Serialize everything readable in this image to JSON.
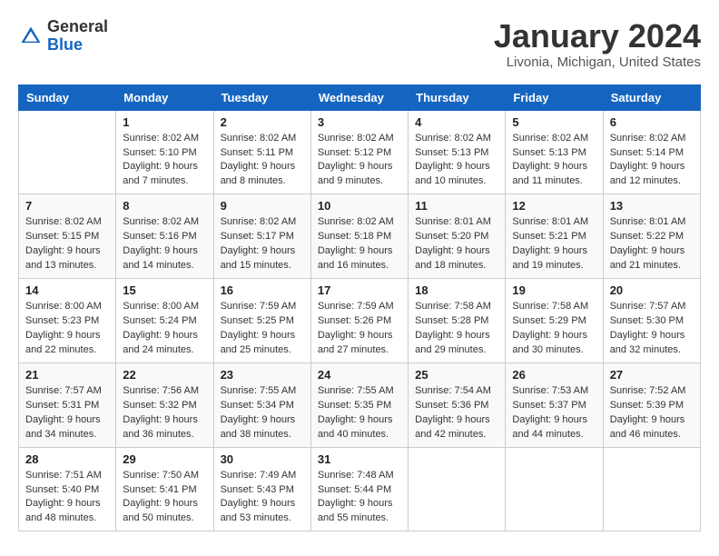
{
  "header": {
    "logo_general": "General",
    "logo_blue": "Blue",
    "title": "January 2024",
    "location": "Livonia, Michigan, United States"
  },
  "days_of_week": [
    "Sunday",
    "Monday",
    "Tuesday",
    "Wednesday",
    "Thursday",
    "Friday",
    "Saturday"
  ],
  "weeks": [
    [
      {
        "day": "",
        "sunrise": "",
        "sunset": "",
        "daylight": ""
      },
      {
        "day": "1",
        "sunrise": "Sunrise: 8:02 AM",
        "sunset": "Sunset: 5:10 PM",
        "daylight": "Daylight: 9 hours and 7 minutes."
      },
      {
        "day": "2",
        "sunrise": "Sunrise: 8:02 AM",
        "sunset": "Sunset: 5:11 PM",
        "daylight": "Daylight: 9 hours and 8 minutes."
      },
      {
        "day": "3",
        "sunrise": "Sunrise: 8:02 AM",
        "sunset": "Sunset: 5:12 PM",
        "daylight": "Daylight: 9 hours and 9 minutes."
      },
      {
        "day": "4",
        "sunrise": "Sunrise: 8:02 AM",
        "sunset": "Sunset: 5:13 PM",
        "daylight": "Daylight: 9 hours and 10 minutes."
      },
      {
        "day": "5",
        "sunrise": "Sunrise: 8:02 AM",
        "sunset": "Sunset: 5:13 PM",
        "daylight": "Daylight: 9 hours and 11 minutes."
      },
      {
        "day": "6",
        "sunrise": "Sunrise: 8:02 AM",
        "sunset": "Sunset: 5:14 PM",
        "daylight": "Daylight: 9 hours and 12 minutes."
      }
    ],
    [
      {
        "day": "7",
        "sunrise": "Sunrise: 8:02 AM",
        "sunset": "Sunset: 5:15 PM",
        "daylight": "Daylight: 9 hours and 13 minutes."
      },
      {
        "day": "8",
        "sunrise": "Sunrise: 8:02 AM",
        "sunset": "Sunset: 5:16 PM",
        "daylight": "Daylight: 9 hours and 14 minutes."
      },
      {
        "day": "9",
        "sunrise": "Sunrise: 8:02 AM",
        "sunset": "Sunset: 5:17 PM",
        "daylight": "Daylight: 9 hours and 15 minutes."
      },
      {
        "day": "10",
        "sunrise": "Sunrise: 8:02 AM",
        "sunset": "Sunset: 5:18 PM",
        "daylight": "Daylight: 9 hours and 16 minutes."
      },
      {
        "day": "11",
        "sunrise": "Sunrise: 8:01 AM",
        "sunset": "Sunset: 5:20 PM",
        "daylight": "Daylight: 9 hours and 18 minutes."
      },
      {
        "day": "12",
        "sunrise": "Sunrise: 8:01 AM",
        "sunset": "Sunset: 5:21 PM",
        "daylight": "Daylight: 9 hours and 19 minutes."
      },
      {
        "day": "13",
        "sunrise": "Sunrise: 8:01 AM",
        "sunset": "Sunset: 5:22 PM",
        "daylight": "Daylight: 9 hours and 21 minutes."
      }
    ],
    [
      {
        "day": "14",
        "sunrise": "Sunrise: 8:00 AM",
        "sunset": "Sunset: 5:23 PM",
        "daylight": "Daylight: 9 hours and 22 minutes."
      },
      {
        "day": "15",
        "sunrise": "Sunrise: 8:00 AM",
        "sunset": "Sunset: 5:24 PM",
        "daylight": "Daylight: 9 hours and 24 minutes."
      },
      {
        "day": "16",
        "sunrise": "Sunrise: 7:59 AM",
        "sunset": "Sunset: 5:25 PM",
        "daylight": "Daylight: 9 hours and 25 minutes."
      },
      {
        "day": "17",
        "sunrise": "Sunrise: 7:59 AM",
        "sunset": "Sunset: 5:26 PM",
        "daylight": "Daylight: 9 hours and 27 minutes."
      },
      {
        "day": "18",
        "sunrise": "Sunrise: 7:58 AM",
        "sunset": "Sunset: 5:28 PM",
        "daylight": "Daylight: 9 hours and 29 minutes."
      },
      {
        "day": "19",
        "sunrise": "Sunrise: 7:58 AM",
        "sunset": "Sunset: 5:29 PM",
        "daylight": "Daylight: 9 hours and 30 minutes."
      },
      {
        "day": "20",
        "sunrise": "Sunrise: 7:57 AM",
        "sunset": "Sunset: 5:30 PM",
        "daylight": "Daylight: 9 hours and 32 minutes."
      }
    ],
    [
      {
        "day": "21",
        "sunrise": "Sunrise: 7:57 AM",
        "sunset": "Sunset: 5:31 PM",
        "daylight": "Daylight: 9 hours and 34 minutes."
      },
      {
        "day": "22",
        "sunrise": "Sunrise: 7:56 AM",
        "sunset": "Sunset: 5:32 PM",
        "daylight": "Daylight: 9 hours and 36 minutes."
      },
      {
        "day": "23",
        "sunrise": "Sunrise: 7:55 AM",
        "sunset": "Sunset: 5:34 PM",
        "daylight": "Daylight: 9 hours and 38 minutes."
      },
      {
        "day": "24",
        "sunrise": "Sunrise: 7:55 AM",
        "sunset": "Sunset: 5:35 PM",
        "daylight": "Daylight: 9 hours and 40 minutes."
      },
      {
        "day": "25",
        "sunrise": "Sunrise: 7:54 AM",
        "sunset": "Sunset: 5:36 PM",
        "daylight": "Daylight: 9 hours and 42 minutes."
      },
      {
        "day": "26",
        "sunrise": "Sunrise: 7:53 AM",
        "sunset": "Sunset: 5:37 PM",
        "daylight": "Daylight: 9 hours and 44 minutes."
      },
      {
        "day": "27",
        "sunrise": "Sunrise: 7:52 AM",
        "sunset": "Sunset: 5:39 PM",
        "daylight": "Daylight: 9 hours and 46 minutes."
      }
    ],
    [
      {
        "day": "28",
        "sunrise": "Sunrise: 7:51 AM",
        "sunset": "Sunset: 5:40 PM",
        "daylight": "Daylight: 9 hours and 48 minutes."
      },
      {
        "day": "29",
        "sunrise": "Sunrise: 7:50 AM",
        "sunset": "Sunset: 5:41 PM",
        "daylight": "Daylight: 9 hours and 50 minutes."
      },
      {
        "day": "30",
        "sunrise": "Sunrise: 7:49 AM",
        "sunset": "Sunset: 5:43 PM",
        "daylight": "Daylight: 9 hours and 53 minutes."
      },
      {
        "day": "31",
        "sunrise": "Sunrise: 7:48 AM",
        "sunset": "Sunset: 5:44 PM",
        "daylight": "Daylight: 9 hours and 55 minutes."
      },
      {
        "day": "",
        "sunrise": "",
        "sunset": "",
        "daylight": ""
      },
      {
        "day": "",
        "sunrise": "",
        "sunset": "",
        "daylight": ""
      },
      {
        "day": "",
        "sunrise": "",
        "sunset": "",
        "daylight": ""
      }
    ]
  ]
}
